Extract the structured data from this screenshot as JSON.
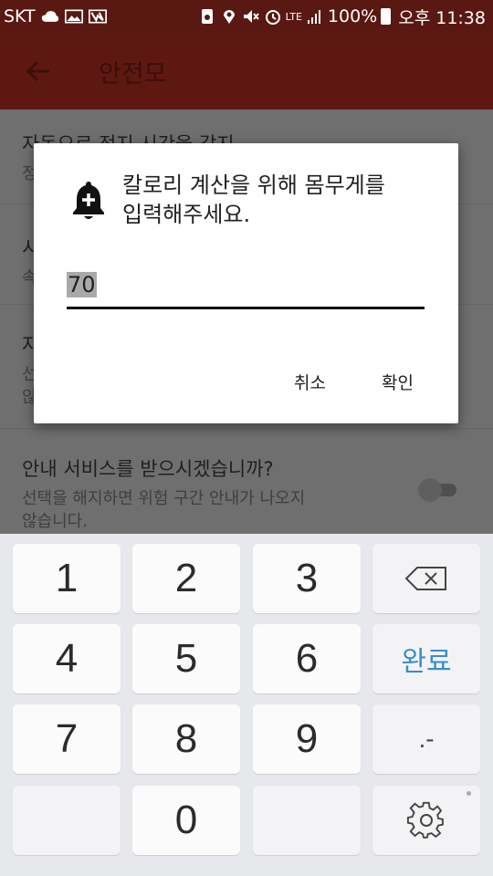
{
  "status_bar": {
    "carrier": "SKT",
    "network": "LTE",
    "battery": "100%",
    "time": "오후 11:38"
  },
  "app_bar": {
    "title": "안전모"
  },
  "settings": [
    {
      "title": "자동으로 정지 시간을 감지",
      "subtitle": "정"
    },
    {
      "title": "시",
      "subtitle": "속"
    },
    {
      "title": "자",
      "subtitle_lines": [
        "선",
        "않"
      ]
    },
    {
      "title": "안내 서비스를 받으시겠습니까?",
      "subtitle_lines": [
        "선택을 해지하면 위험 구간 안내가 나오지",
        "않습니다."
      ]
    }
  ],
  "dialog": {
    "message_lines": [
      "칼로리 계산을 위해 몸무게를",
      "입력해주세요."
    ],
    "input_value": "70",
    "cancel_label": "취소",
    "ok_label": "확인"
  },
  "keyboard": {
    "row1": [
      "1",
      "2",
      "3"
    ],
    "row2": [
      "4",
      "5",
      "6"
    ],
    "row3": [
      "7",
      "8",
      "9"
    ],
    "row4_center": "0",
    "done_label": "완료",
    "symbol_label": ".-"
  }
}
